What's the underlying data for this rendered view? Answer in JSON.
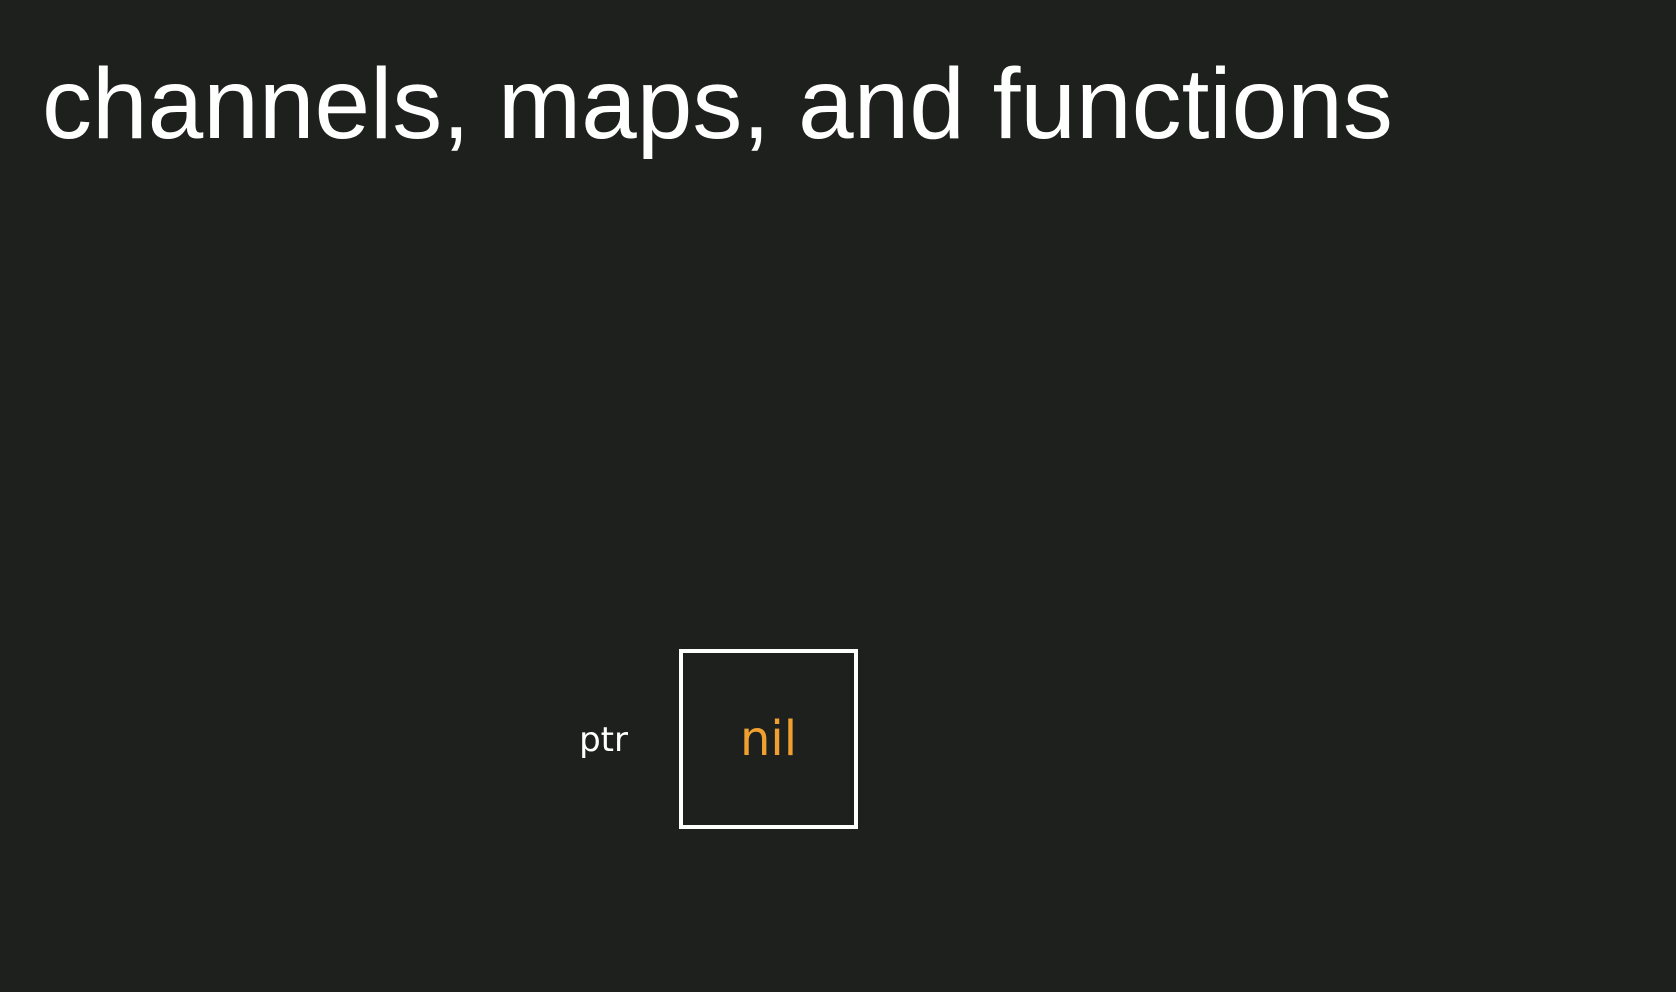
{
  "slide": {
    "title": "channels, maps, and functions"
  },
  "diagram": {
    "variable": {
      "name": "ptr",
      "value": "nil"
    }
  },
  "colors": {
    "background": "#1e201e",
    "text": "#ffffff",
    "box_border": "#ffffff",
    "value_accent": "#f0a030"
  }
}
